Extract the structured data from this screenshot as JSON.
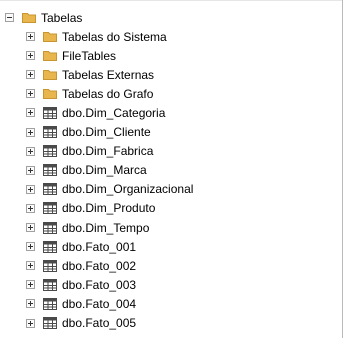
{
  "tree": {
    "root": {
      "label": "Tabelas",
      "state": "expanded"
    },
    "items": [
      {
        "label": "Tabelas do Sistema",
        "kind": "folder"
      },
      {
        "label": "FileTables",
        "kind": "folder"
      },
      {
        "label": "Tabelas Externas",
        "kind": "folder"
      },
      {
        "label": "Tabelas do Grafo",
        "kind": "folder"
      },
      {
        "label": "dbo.Dim_Categoria",
        "kind": "table"
      },
      {
        "label": "dbo.Dim_Cliente",
        "kind": "table"
      },
      {
        "label": "dbo.Dim_Fabrica",
        "kind": "table"
      },
      {
        "label": "dbo.Dim_Marca",
        "kind": "table"
      },
      {
        "label": "dbo.Dim_Organizacional",
        "kind": "table"
      },
      {
        "label": "dbo.Dim_Produto",
        "kind": "table"
      },
      {
        "label": "dbo.Dim_Tempo",
        "kind": "table"
      },
      {
        "label": "dbo.Fato_001",
        "kind": "table"
      },
      {
        "label": "dbo.Fato_002",
        "kind": "table"
      },
      {
        "label": "dbo.Fato_003",
        "kind": "table"
      },
      {
        "label": "dbo.Fato_004",
        "kind": "table"
      },
      {
        "label": "dbo.Fato_005",
        "kind": "table"
      }
    ]
  },
  "colors": {
    "folder": "#e8b64c",
    "table_icon": "#4a4a4a",
    "border": "#b9b9b9"
  }
}
